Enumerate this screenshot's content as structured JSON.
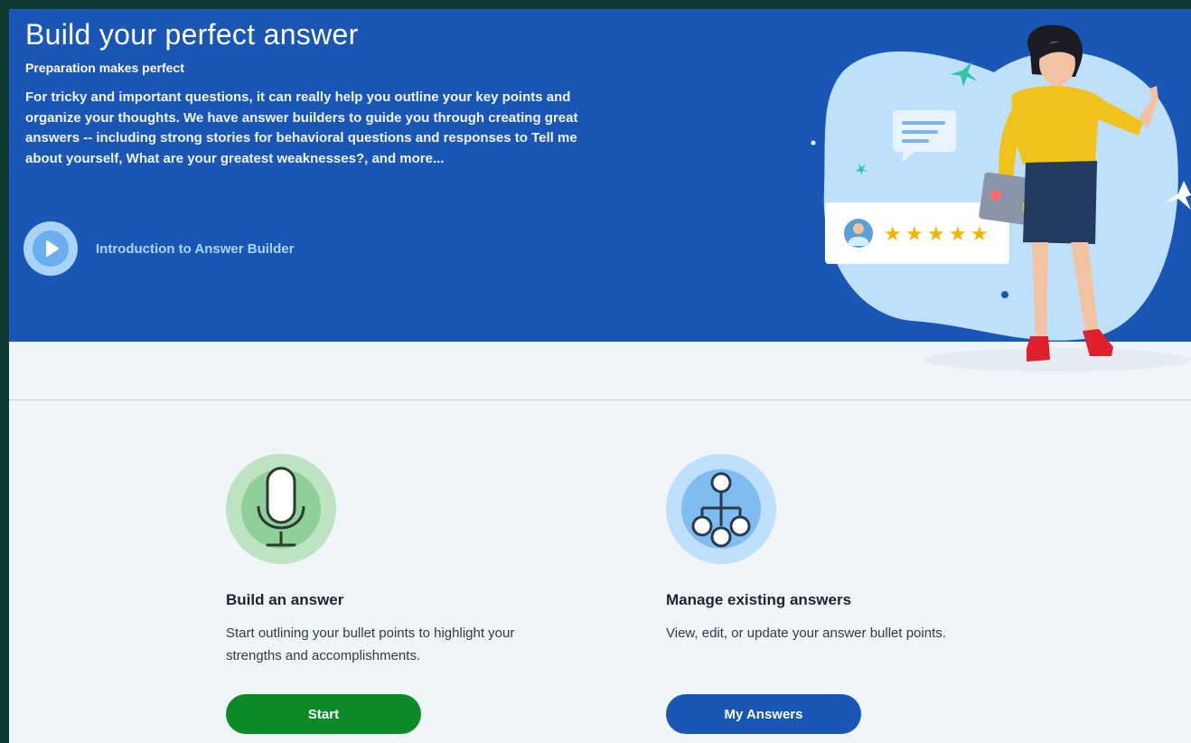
{
  "hero": {
    "title": "Build your perfect answer",
    "subtitle": "Preparation makes perfect",
    "description": "For tricky and important questions, it can really help you outline your key points and organize your thoughts. We have answer builders to guide you through creating great answers -- including strong stories for behavioral questions and responses to Tell me about yourself, What are your greatest weaknesses?, and more...",
    "video_link_label": "Introduction to Answer Builder"
  },
  "illustration": {
    "rating_stars": 5,
    "rating_star_glyph": "★"
  },
  "cards": {
    "build": {
      "icon": "microphone-icon",
      "title": "Build an answer",
      "description": "Start outlining your bullet points to highlight your strengths and accomplishments.",
      "button_label": "Start"
    },
    "manage": {
      "icon": "tree-structure-icon",
      "title": "Manage existing answers",
      "description": "View, edit, or update your answer bullet points.",
      "button_label": "My Answers"
    }
  },
  "colors": {
    "hero_background": "#1a56b5",
    "page_background": "#f0f5fa",
    "start_button": "#0b8a27",
    "answers_button": "#1a56b5",
    "star": "#f5b301"
  }
}
